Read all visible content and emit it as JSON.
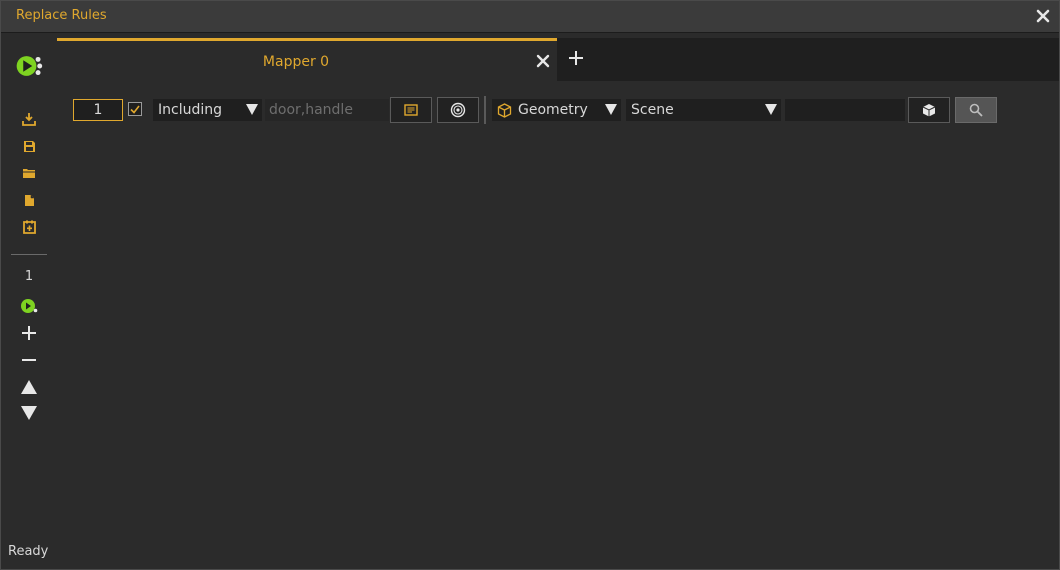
{
  "window": {
    "title": "Replace Rules"
  },
  "sidebar": {
    "buttons": [
      {
        "icon": "run-all-icon"
      },
      {
        "icon": "import-icon"
      },
      {
        "icon": "save-icon"
      },
      {
        "icon": "open-folder-icon"
      },
      {
        "icon": "new-file-icon"
      },
      {
        "icon": "save-as-icon"
      }
    ],
    "rule_count": "1"
  },
  "tabs": [
    {
      "label": "Mapper 0",
      "active": true
    }
  ],
  "rule": {
    "number": "1",
    "enabled": true,
    "mode": "Including",
    "name_placeholder": "door,handle",
    "name_value": "",
    "type": "Geometry",
    "scope": "Scene",
    "search_value": ""
  },
  "status": "Ready",
  "colors": {
    "accent": "#e0a82e",
    "run_green": "#7ed321",
    "background": "#2b2b2b"
  }
}
